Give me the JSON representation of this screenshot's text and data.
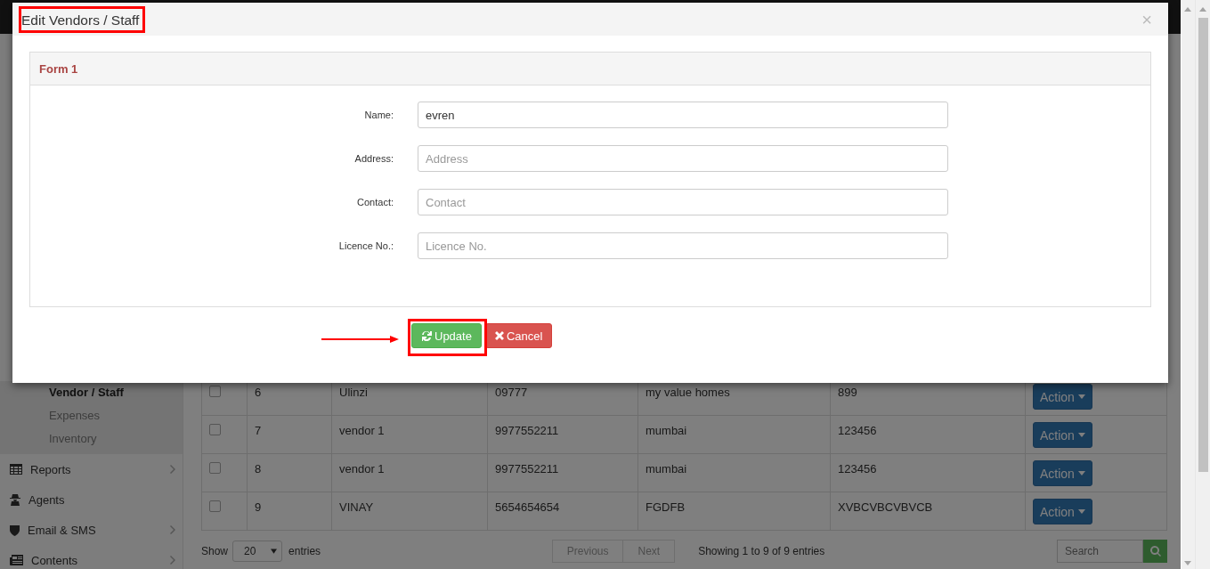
{
  "sidebar": {
    "sub_items": [
      {
        "label": "Vendor / Staff",
        "selected": true
      },
      {
        "label": "Expenses",
        "selected": false
      },
      {
        "label": "Inventory",
        "selected": false
      }
    ],
    "items": [
      {
        "kind": "reports",
        "label": "Reports",
        "has_submenu": true
      },
      {
        "kind": "agents",
        "label": "Agents",
        "has_submenu": false
      },
      {
        "kind": "email",
        "label": "Email & SMS",
        "has_submenu": true
      },
      {
        "kind": "contents",
        "label": "Contents",
        "has_submenu": true
      }
    ]
  },
  "table": {
    "rows": [
      {
        "checked": false,
        "cells": [
          "6",
          "Ulinzi",
          "09777",
          "my value homes",
          "899"
        ],
        "action": "Action"
      },
      {
        "checked": false,
        "cells": [
          "7",
          "vendor 1",
          "9977552211",
          "mumbai",
          "123456"
        ],
        "action": "Action"
      },
      {
        "checked": false,
        "cells": [
          "8",
          "vendor 1",
          "9977552211",
          "mumbai",
          "123456"
        ],
        "action": "Action"
      },
      {
        "checked": false,
        "cells": [
          "9",
          "VINAY",
          "5654654654",
          "FGDFB",
          "XVBCVBCVBVCB"
        ],
        "action": "Action"
      }
    ],
    "footer": {
      "show_label": "Show",
      "page_size": "20",
      "entries_label": "entries",
      "previous": "Previous",
      "next": "Next",
      "info": "Showing 1 to 9 of 9 entries",
      "search_placeholder": "Search"
    }
  },
  "modal": {
    "title": "Edit Vendors / Staff",
    "close": "×",
    "panel": {
      "heading": "Form 1",
      "fields": [
        {
          "label": "Name:",
          "value": "evren"
        },
        {
          "label": "Address:",
          "placeholder": "Address"
        },
        {
          "label": "Contact:",
          "placeholder": "Contact"
        },
        {
          "label": "Licence No.:",
          "placeholder": "Licence No."
        }
      ]
    },
    "buttons": [
      {
        "kind": "update",
        "label": "Update"
      },
      {
        "kind": "cancel",
        "label": "Cancel"
      }
    ]
  }
}
